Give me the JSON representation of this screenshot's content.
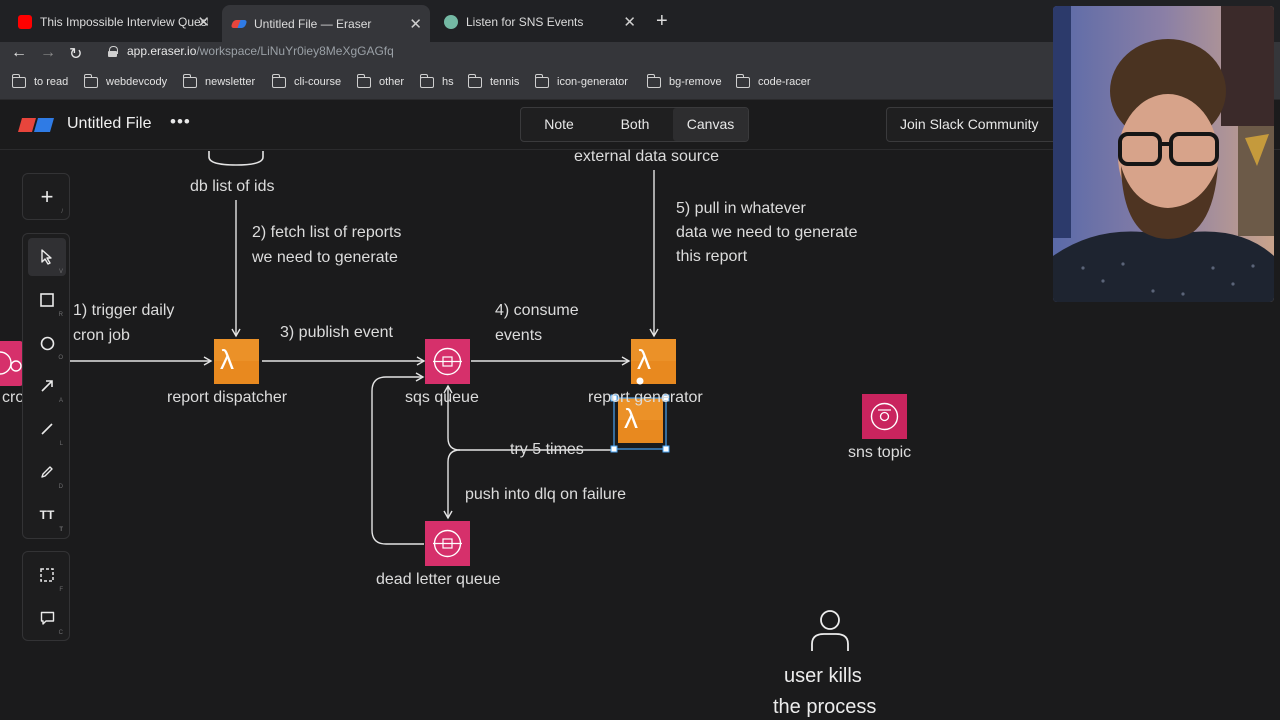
{
  "browser": {
    "tabs": [
      {
        "title": "This Impossible Interview Question",
        "favicon_color": "#ff0000",
        "active": false
      },
      {
        "title": "Untitled File — Eraser",
        "favicon_color": "#e8453c",
        "active": true
      },
      {
        "title": "Listen for SNS Events",
        "favicon_color": "#74b9a4",
        "active": false
      }
    ],
    "url_host": "app.eraser.io",
    "url_path": "/workspace/LiNuYr0iey8MeXgGAGfq",
    "bookmarks": [
      "to read",
      "webdevcody",
      "newsletter",
      "cli-course",
      "other",
      "hs",
      "tennis",
      "icon-generator",
      "bg-remove",
      "code-racer"
    ]
  },
  "app": {
    "file_name": "Untitled File",
    "more_label": "•••",
    "view_modes": [
      "Note",
      "Both",
      "Canvas"
    ],
    "active_view": "Canvas",
    "slack_label": "Join Slack Community"
  },
  "tools": {
    "add_key": "/",
    "items": [
      {
        "name": "select",
        "key": "V"
      },
      {
        "name": "rectangle",
        "key": "R"
      },
      {
        "name": "ellipse",
        "key": "O"
      },
      {
        "name": "arrow",
        "key": "A"
      },
      {
        "name": "line",
        "key": "L"
      },
      {
        "name": "pencil",
        "key": "D"
      },
      {
        "name": "text",
        "key": "T"
      }
    ],
    "frame_key": "F",
    "comment_key": "C"
  },
  "diagram": {
    "db_label": "db list of ids",
    "external_label": "external data source",
    "step1": [
      "1) trigger daily",
      "cron job"
    ],
    "step2": [
      "2) fetch list of reports",
      "we need to generate"
    ],
    "step3": "3) publish event",
    "step4": [
      "4) consume",
      "events"
    ],
    "step5": [
      "5) pull in whatever",
      "data we need to generate",
      "this report"
    ],
    "report_dispatcher": "report dispatcher",
    "sqs_queue": "sqs queue",
    "report_generator": "report generator",
    "cron_label": "cro",
    "retry_label": "try 5 times",
    "dlq_label": "push into dlq on failure",
    "dead_letter_queue": "dead letter queue",
    "sns_topic": "sns topic",
    "user_label": [
      "user kills",
      "the process"
    ],
    "lambda_glyph": "λ",
    "colors": {
      "lambda": "#e8891f",
      "queue": "#d6306b",
      "sns": "#c9245e",
      "selection": "#4aa3f0"
    }
  }
}
